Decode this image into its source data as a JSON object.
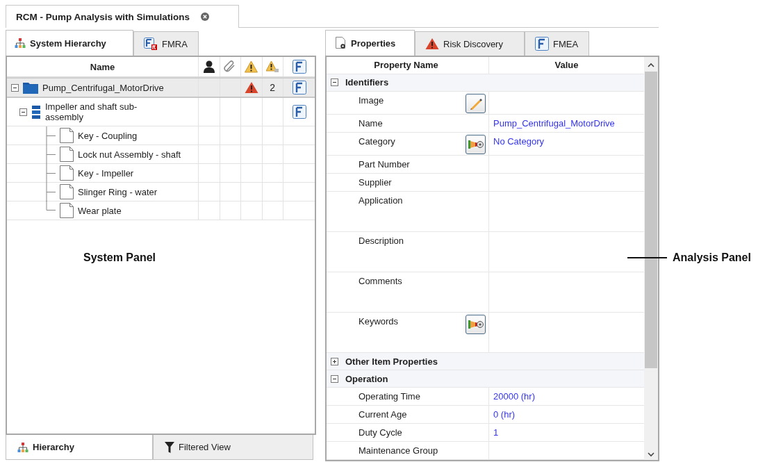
{
  "document_tab": {
    "title": "RCM - Pump Analysis with Simulations",
    "selected": true
  },
  "system_panel": {
    "tabs": [
      {
        "label": "System Hierarchy",
        "kind": "hierarchy",
        "selected": true
      },
      {
        "label": "FMRA",
        "kind": "fmra",
        "selected": false
      }
    ],
    "name_column": "Name",
    "tree": [
      {
        "name": "Pump_Centrifugal_MotorDrive",
        "kind": "system",
        "expanded": true,
        "selected": true,
        "warning": true,
        "count": "2",
        "fmea": true,
        "children": [
          {
            "name": "Impeller and shaft sub-assembly",
            "kind": "assembly",
            "expanded": true,
            "selected": false,
            "warning": false,
            "fmea": true,
            "children": [
              {
                "name": "Key - Coupling",
                "kind": "part",
                "selected": false,
                "warning": false,
                "fmea": false
              },
              {
                "name": "Lock nut Assembly - shaft",
                "kind": "part",
                "selected": false,
                "warning": false,
                "fmea": false
              },
              {
                "name": "Key - Impeller",
                "kind": "part",
                "selected": false,
                "warning": false,
                "fmea": false
              },
              {
                "name": "Slinger Ring - water",
                "kind": "part",
                "selected": false,
                "warning": false,
                "fmea": false
              },
              {
                "name": "Wear plate",
                "kind": "part",
                "selected": false,
                "warning": false,
                "fmea": false
              }
            ]
          }
        ]
      }
    ],
    "bottom_tabs": [
      {
        "label": "Hierarchy",
        "kind": "hierarchy",
        "selected": true
      },
      {
        "label": "Filtered View",
        "kind": "filter",
        "selected": false
      }
    ]
  },
  "analysis_panel": {
    "tabs": [
      {
        "label": "Properties",
        "kind": "properties",
        "selected": true
      },
      {
        "label": "Risk Discovery",
        "kind": "risk",
        "selected": false
      },
      {
        "label": "FMEA",
        "kind": "fmea",
        "selected": false
      }
    ],
    "columns": [
      "Property Name",
      "Value"
    ],
    "groups": [
      {
        "name": "Identifiers",
        "expanded": true,
        "properties": [
          {
            "name": "Image",
            "kind": "single",
            "edit_button": true
          },
          {
            "name": "Name",
            "kind": "single",
            "value": "Pump_Centrifugal_MotorDrive"
          },
          {
            "name": "Category",
            "kind": "single",
            "picker_button": true,
            "value": "No Category"
          },
          {
            "name": "Part Number",
            "kind": "single"
          },
          {
            "name": "Supplier",
            "kind": "single"
          },
          {
            "name": "Application",
            "kind": "multiline"
          },
          {
            "name": "Description",
            "kind": "multiline"
          },
          {
            "name": "Comments",
            "kind": "multiline"
          },
          {
            "name": "Keywords",
            "kind": "multiline",
            "picker_button": true
          }
        ]
      },
      {
        "name": "Other Item Properties",
        "expanded": false
      },
      {
        "name": "Operation",
        "expanded": true,
        "properties": [
          {
            "name": "Operating Time",
            "kind": "single",
            "value": "20000 (hr)"
          },
          {
            "name": "Current Age",
            "kind": "single",
            "value": "0 (hr)"
          },
          {
            "name": "Duty Cycle",
            "kind": "single",
            "value": "1"
          },
          {
            "name": "Maintenance Group",
            "kind": "single"
          }
        ]
      }
    ]
  },
  "annotations": [
    {
      "label": "System Panel",
      "leader": false
    },
    {
      "label": "Analysis Panel",
      "leader": true
    }
  ]
}
